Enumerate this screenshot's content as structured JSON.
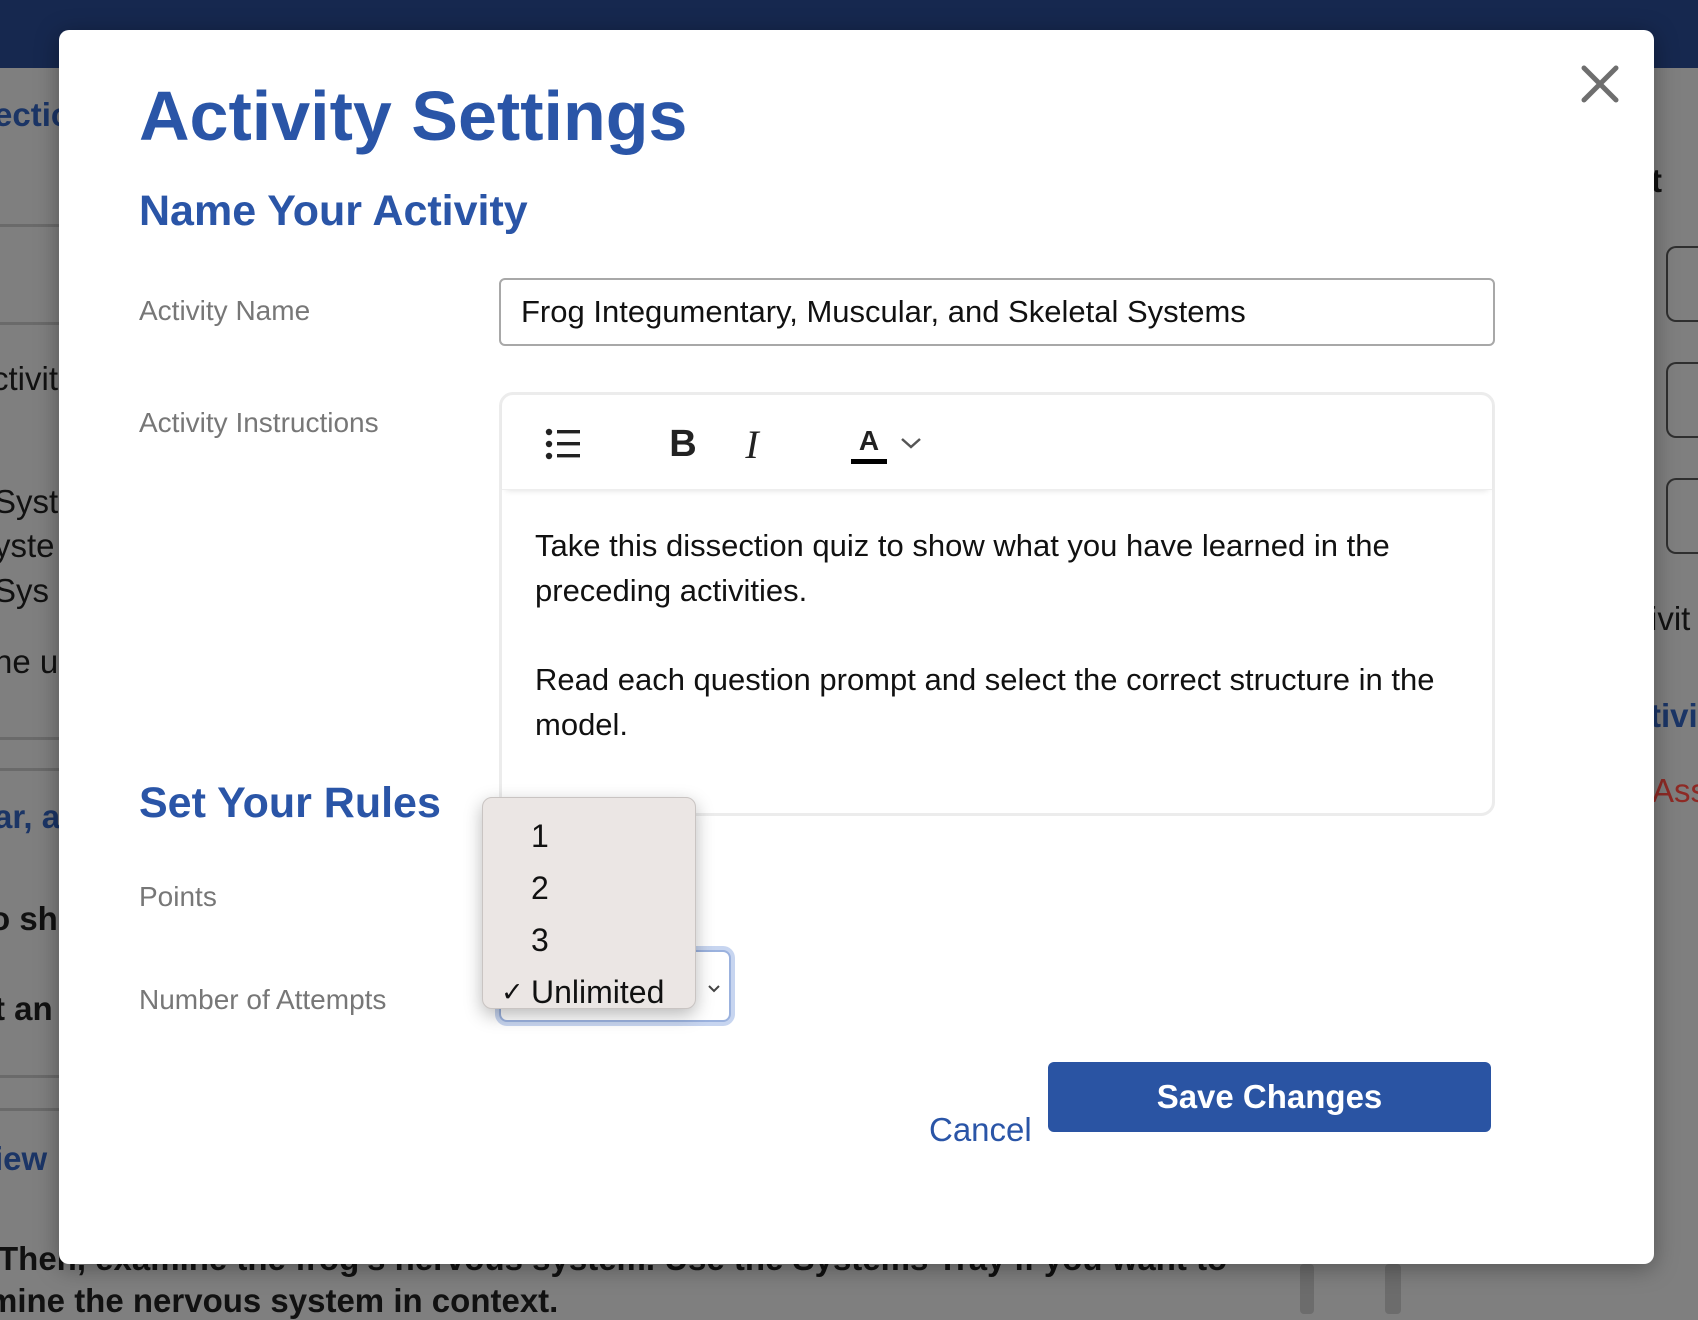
{
  "background": {
    "left_fragments": [
      "ectio",
      "ctivit",
      "Syste",
      "yste",
      " Sys",
      "ne u",
      "ar, a",
      "o sho",
      "t an",
      "iew"
    ],
    "right_fragments": [
      "ft",
      "ivit",
      "tivit",
      "Ass"
    ],
    "bottom_lines": [
      "Then, examine the frog's nervous system. Use the Systems Tray if you want to",
      "mine the nervous system in context."
    ]
  },
  "modal": {
    "title": "Activity Settings",
    "close_icon": "close-icon",
    "name_section": {
      "heading": "Name Your Activity",
      "activity_name_label": "Activity Name",
      "activity_name_value": "Frog Integumentary, Muscular, and Skeletal Systems",
      "instructions_label": "Activity Instructions",
      "toolbar": {
        "list_icon": "bulleted-list-icon",
        "bold_label": "B",
        "italic_label": "I",
        "text_color_label": "A",
        "text_color_icon": "text-color-icon",
        "caret_icon": "chevron-down-icon"
      },
      "instructions_paragraphs": [
        "Take this dissection quiz to show what you have learned in the preceding activities.",
        "Read each question prompt and select the correct structure in the model."
      ]
    },
    "rules_section": {
      "heading": "Set Your Rules",
      "points_label": "Points",
      "attempts_label": "Number of Attempts",
      "attempts_options": [
        "1",
        "2",
        "3",
        "Unlimited"
      ],
      "attempts_selected": "Unlimited",
      "check_mark": "✓"
    },
    "footer": {
      "cancel_label": "Cancel",
      "save_label": "Save Changes"
    }
  },
  "colors": {
    "accent": "#2a55a7",
    "save_button": "#2a54a3",
    "topbar": "#16284f",
    "overlay": "#7f7f7f"
  }
}
